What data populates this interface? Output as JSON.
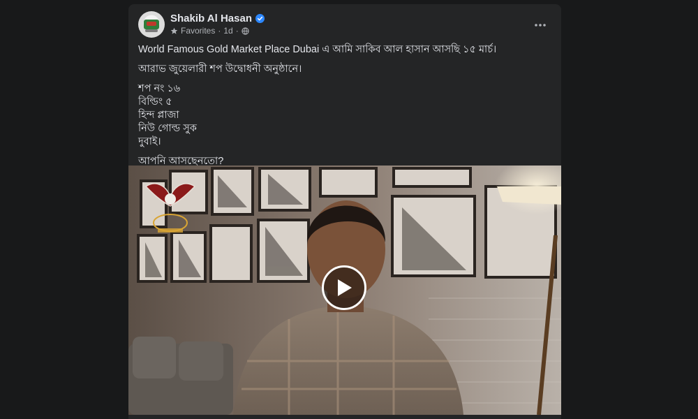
{
  "post": {
    "author": "Shakib Al Hasan",
    "meta": {
      "audience_label": "Favorites",
      "separator": "·",
      "time": "1d"
    },
    "text": {
      "line1": "World Famous Gold Market Place Dubai এ আমি সাকিব আল হাসান আসছি ১৫ মার্চ।",
      "line2": "আরাভ জুয়েলারী শপ উদ্বোধনী অনুষ্ঠানে।",
      "address": [
        "শপ নং ১৬",
        "বিল্ডিং ৫",
        "হিন্দ প্লাজা",
        "নিউ গোল্ড সুক",
        "দুবাই।"
      ],
      "question": "আপনি আসছেনতো?"
    }
  },
  "icons": {
    "verified": "verified-badge-icon",
    "favorites": "star-icon",
    "audience": "globe-icon",
    "more": "more-options-icon",
    "play": "play-icon"
  },
  "colors": {
    "page_bg": "#18191a",
    "card_bg": "#242526",
    "text_primary": "#e4e6eb",
    "text_secondary": "#b0b3b8",
    "verified_blue": "#2d88ff"
  }
}
